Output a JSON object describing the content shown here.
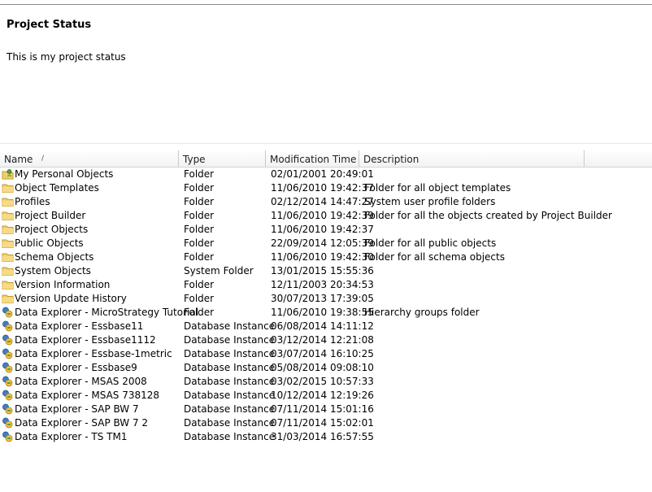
{
  "status": {
    "title": "Project Status",
    "text": "This is my project status"
  },
  "columns": {
    "name": "Name",
    "name_sort_indicator": "/",
    "type": "Type",
    "modified": "Modification Time",
    "description": "Description"
  },
  "rows": [
    {
      "name": "My Personal Objects",
      "type": "Folder",
      "modified": "02/01/2001 20:49:01",
      "description": "",
      "icon": "personal-folder-icon"
    },
    {
      "name": "Object Templates",
      "type": "Folder",
      "modified": "11/06/2010 19:42:37",
      "description": "Folder for all object templates",
      "icon": "folder-icon"
    },
    {
      "name": "Profiles",
      "type": "Folder",
      "modified": "02/12/2014 14:47:27",
      "description": "System user profile folders",
      "icon": "folder-icon"
    },
    {
      "name": "Project Builder",
      "type": "Folder",
      "modified": "11/06/2010 19:42:39",
      "description": "Folder for all the objects created by Project Builder",
      "icon": "folder-icon"
    },
    {
      "name": "Project Objects",
      "type": "Folder",
      "modified": "11/06/2010 19:42:37",
      "description": "",
      "icon": "folder-icon"
    },
    {
      "name": "Public Objects",
      "type": "Folder",
      "modified": "22/09/2014 12:05:39",
      "description": "Folder for all public objects",
      "icon": "folder-icon"
    },
    {
      "name": "Schema Objects",
      "type": "Folder",
      "modified": "11/06/2010 19:42:30",
      "description": "Folder for all schema objects",
      "icon": "folder-icon"
    },
    {
      "name": "System Objects",
      "type": "System Folder",
      "modified": "13/01/2015 15:55:36",
      "description": "",
      "icon": "folder-icon"
    },
    {
      "name": "Version Information",
      "type": "Folder",
      "modified": "12/11/2003 20:34:53",
      "description": "",
      "icon": "folder-icon"
    },
    {
      "name": "Version Update History",
      "type": "Folder",
      "modified": "30/07/2013 17:39:05",
      "description": "",
      "icon": "folder-icon"
    },
    {
      "name": "Data Explorer - MicroStrategy Tutorial",
      "type": "Folder",
      "modified": "11/06/2010 19:38:55",
      "description": "Hierarchy groups folder",
      "icon": "database-instance-icon"
    },
    {
      "name": "Data Explorer - Essbase11",
      "type": "Database Instance",
      "modified": "06/08/2014 14:11:12",
      "description": "",
      "icon": "database-instance-icon"
    },
    {
      "name": "Data Explorer - Essbase1112",
      "type": "Database Instance",
      "modified": "03/12/2014 12:21:08",
      "description": "",
      "icon": "database-instance-icon"
    },
    {
      "name": "Data Explorer - Essbase-1metric",
      "type": "Database Instance",
      "modified": "03/07/2014 16:10:25",
      "description": "",
      "icon": "database-instance-icon"
    },
    {
      "name": "Data Explorer - Essbase9",
      "type": "Database Instance",
      "modified": "05/08/2014 09:08:10",
      "description": "",
      "icon": "database-instance-icon"
    },
    {
      "name": "Data Explorer - MSAS 2008",
      "type": "Database Instance",
      "modified": "03/02/2015 10:57:33",
      "description": "",
      "icon": "database-instance-icon"
    },
    {
      "name": "Data Explorer - MSAS 738128",
      "type": "Database Instance",
      "modified": "10/12/2014 12:19:26",
      "description": "",
      "icon": "database-instance-icon"
    },
    {
      "name": "Data Explorer - SAP BW 7",
      "type": "Database Instance",
      "modified": "07/11/2014 15:01:16",
      "description": "",
      "icon": "database-instance-icon"
    },
    {
      "name": "Data Explorer - SAP BW 7 2",
      "type": "Database Instance",
      "modified": "07/11/2014 15:02:01",
      "description": "",
      "icon": "database-instance-icon"
    },
    {
      "name": "Data Explorer - TS TM1",
      "type": "Database Instance",
      "modified": "31/03/2014 16:57:55",
      "description": "",
      "icon": "database-instance-icon"
    }
  ]
}
